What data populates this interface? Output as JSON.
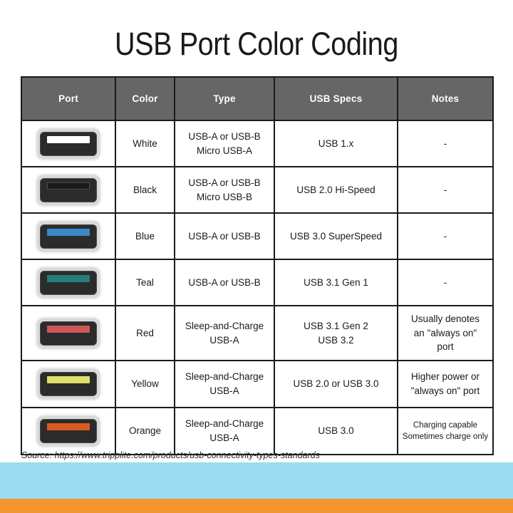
{
  "title": "USB Port Color Coding",
  "table": {
    "headers": [
      "Port",
      "Color",
      "Type",
      "USB Specs",
      "Notes"
    ],
    "rows": [
      {
        "port_icon": "usb-port-white-icon",
        "bar_color": "#ffffff",
        "color": "White",
        "type_line1": "USB-A or USB-B",
        "type_line2": "Micro USB-A",
        "specs_line1": "USB 1.x",
        "specs_line2": "",
        "notes_line1": "-",
        "notes_line2": "",
        "notes_line3": ""
      },
      {
        "port_icon": "usb-port-black-icon",
        "bar_color": "#1a1a1a",
        "color": "Black",
        "type_line1": "USB-A or USB-B",
        "type_line2": "Micro USB-B",
        "specs_line1": "USB 2.0 Hi-Speed",
        "specs_line2": "",
        "notes_line1": "-",
        "notes_line2": "",
        "notes_line3": ""
      },
      {
        "port_icon": "usb-port-blue-icon",
        "bar_color": "#3d87cc",
        "color": "Blue",
        "type_line1": "USB-A or USB-B",
        "type_line2": "",
        "specs_line1": "USB 3.0 SuperSpeed",
        "specs_line2": "",
        "notes_line1": "-",
        "notes_line2": "",
        "notes_line3": ""
      },
      {
        "port_icon": "usb-port-teal-icon",
        "bar_color": "#257e77",
        "color": "Teal",
        "type_line1": "USB-A or USB-B",
        "type_line2": "",
        "specs_line1": "USB 3.1 Gen 1",
        "specs_line2": "",
        "notes_line1": "-",
        "notes_line2": "",
        "notes_line3": ""
      },
      {
        "port_icon": "usb-port-red-icon",
        "bar_color": "#cf5858",
        "color": "Red",
        "type_line1": "Sleep-and-Charge",
        "type_line2": "USB-A",
        "specs_line1": "USB 3.1 Gen 2",
        "specs_line2": "USB 3.2",
        "notes_line1": "Usually denotes",
        "notes_line2": "an \"always on\"",
        "notes_line3": "port"
      },
      {
        "port_icon": "usb-port-yellow-icon",
        "bar_color": "#dfe06a",
        "color": "Yellow",
        "type_line1": "Sleep-and-Charge",
        "type_line2": "USB-A",
        "specs_line1": "USB 2.0 or USB 3.0",
        "specs_line2": "",
        "notes_line1": "Higher power or",
        "notes_line2": "\"always on\" port",
        "notes_line3": ""
      },
      {
        "port_icon": "usb-port-orange-icon",
        "bar_color": "#d85a1e",
        "color": "Orange",
        "type_line1": "Sleep-and-Charge",
        "type_line2": "USB-A",
        "specs_line1": "USB 3.0",
        "specs_line2": "",
        "notes_line1": "Charging capable",
        "notes_line2": "Sometimes charge only",
        "notes_line3": ""
      }
    ]
  },
  "source": "Source: https://www.tripplite.com/products/usb-connectivity-types-standards",
  "colors": {
    "header_bg": "#666666",
    "border": "#1a1a1a",
    "band_blue": "#9bdcf0",
    "band_orange": "#f2952c",
    "port_frame": "#d9d9d9",
    "port_body": "#2b2b2b"
  }
}
